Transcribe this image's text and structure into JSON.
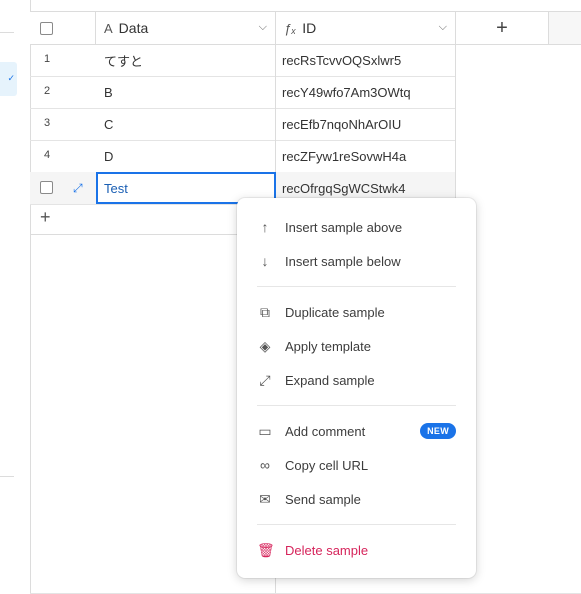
{
  "sidebar": {
    "selected_mark": "✓"
  },
  "grid": {
    "columns": [
      {
        "label": "Data",
        "icon": "text-icon"
      },
      {
        "label": "ID",
        "icon": "formula-icon"
      }
    ],
    "add_column_label": "+",
    "rows": [
      {
        "num": "1",
        "data": "てすと",
        "id": "recRsTcvvOQSxlwr5"
      },
      {
        "num": "2",
        "data": "B",
        "id": "recY49wfo7Am3OWtq"
      },
      {
        "num": "3",
        "data": "C",
        "id": "recEfb7nqoNhArOIU"
      },
      {
        "num": "4",
        "data": "D",
        "id": "recZFyw1reSovwH4a"
      },
      {
        "num": "",
        "data": "Test",
        "id": "recOfrgqSgWCStwk4"
      }
    ],
    "add_row_label": "+"
  },
  "context_menu": {
    "items": [
      {
        "label": "Insert sample above",
        "icon": "arrow-up-icon"
      },
      {
        "label": "Insert sample below",
        "icon": "arrow-down-icon"
      },
      {
        "label": "Duplicate sample",
        "icon": "duplicate-icon"
      },
      {
        "label": "Apply template",
        "icon": "paint-bucket-icon"
      },
      {
        "label": "Expand sample",
        "icon": "expand-icon"
      },
      {
        "label": "Add comment",
        "icon": "comment-icon",
        "badge": "NEW"
      },
      {
        "label": "Copy cell URL",
        "icon": "link-icon"
      },
      {
        "label": "Send sample",
        "icon": "mail-icon"
      },
      {
        "label": "Delete sample",
        "icon": "trash-icon"
      }
    ]
  },
  "colors": {
    "accent": "#1a73e8",
    "danger": "#d6245b",
    "border": "#dcdcdc"
  }
}
